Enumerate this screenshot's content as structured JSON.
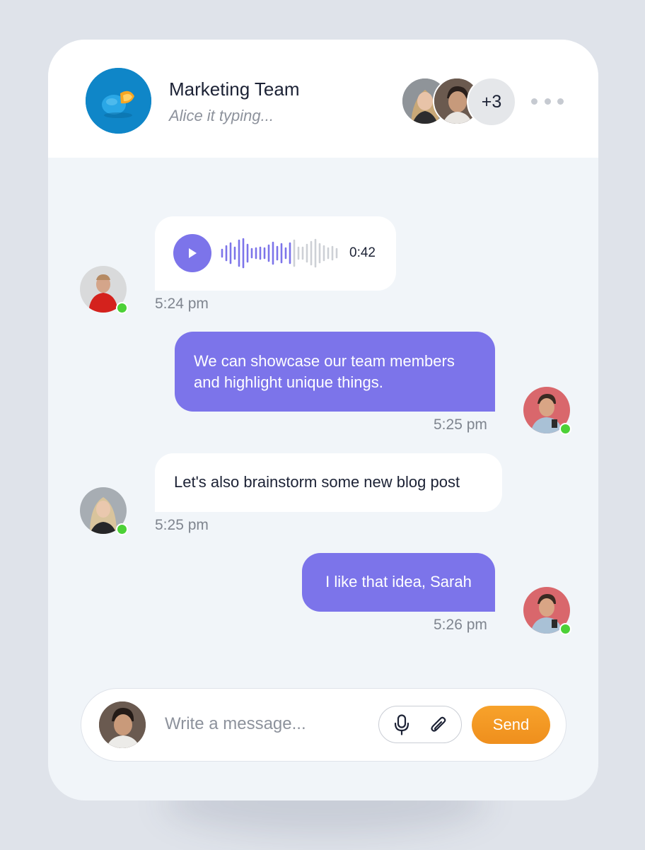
{
  "header": {
    "group_name": "Marketing Team",
    "status": "Alice it typing...",
    "extra_members": "+3",
    "more_icon": "more-horizontal-icon"
  },
  "messages": [
    {
      "kind": "voice",
      "direction": "incoming",
      "duration": "0:42",
      "time": "5:24 pm",
      "online": true
    },
    {
      "kind": "text",
      "direction": "outgoing",
      "lines": [
        "We can showcase our team members",
        "and highlight unique things."
      ],
      "time": "5:25 pm",
      "online": true
    },
    {
      "kind": "text",
      "direction": "incoming",
      "text": "Let's also brainstorm some new blog post",
      "time": "5:25 pm",
      "online": true
    },
    {
      "kind": "text",
      "direction": "outgoing",
      "text": "I like that idea, Sarah",
      "time": "5:26 pm",
      "online": true
    }
  ],
  "composer": {
    "placeholder": "Write a message...",
    "send_label": "Send",
    "mic_icon": "microphone-icon",
    "attach_icon": "paperclip-icon"
  },
  "colors": {
    "accent": "#7c74ea",
    "send": "#f39a24",
    "online": "#4cd137",
    "page_bg": "#dfe3ea",
    "chat_bg": "#f1f5f9"
  }
}
